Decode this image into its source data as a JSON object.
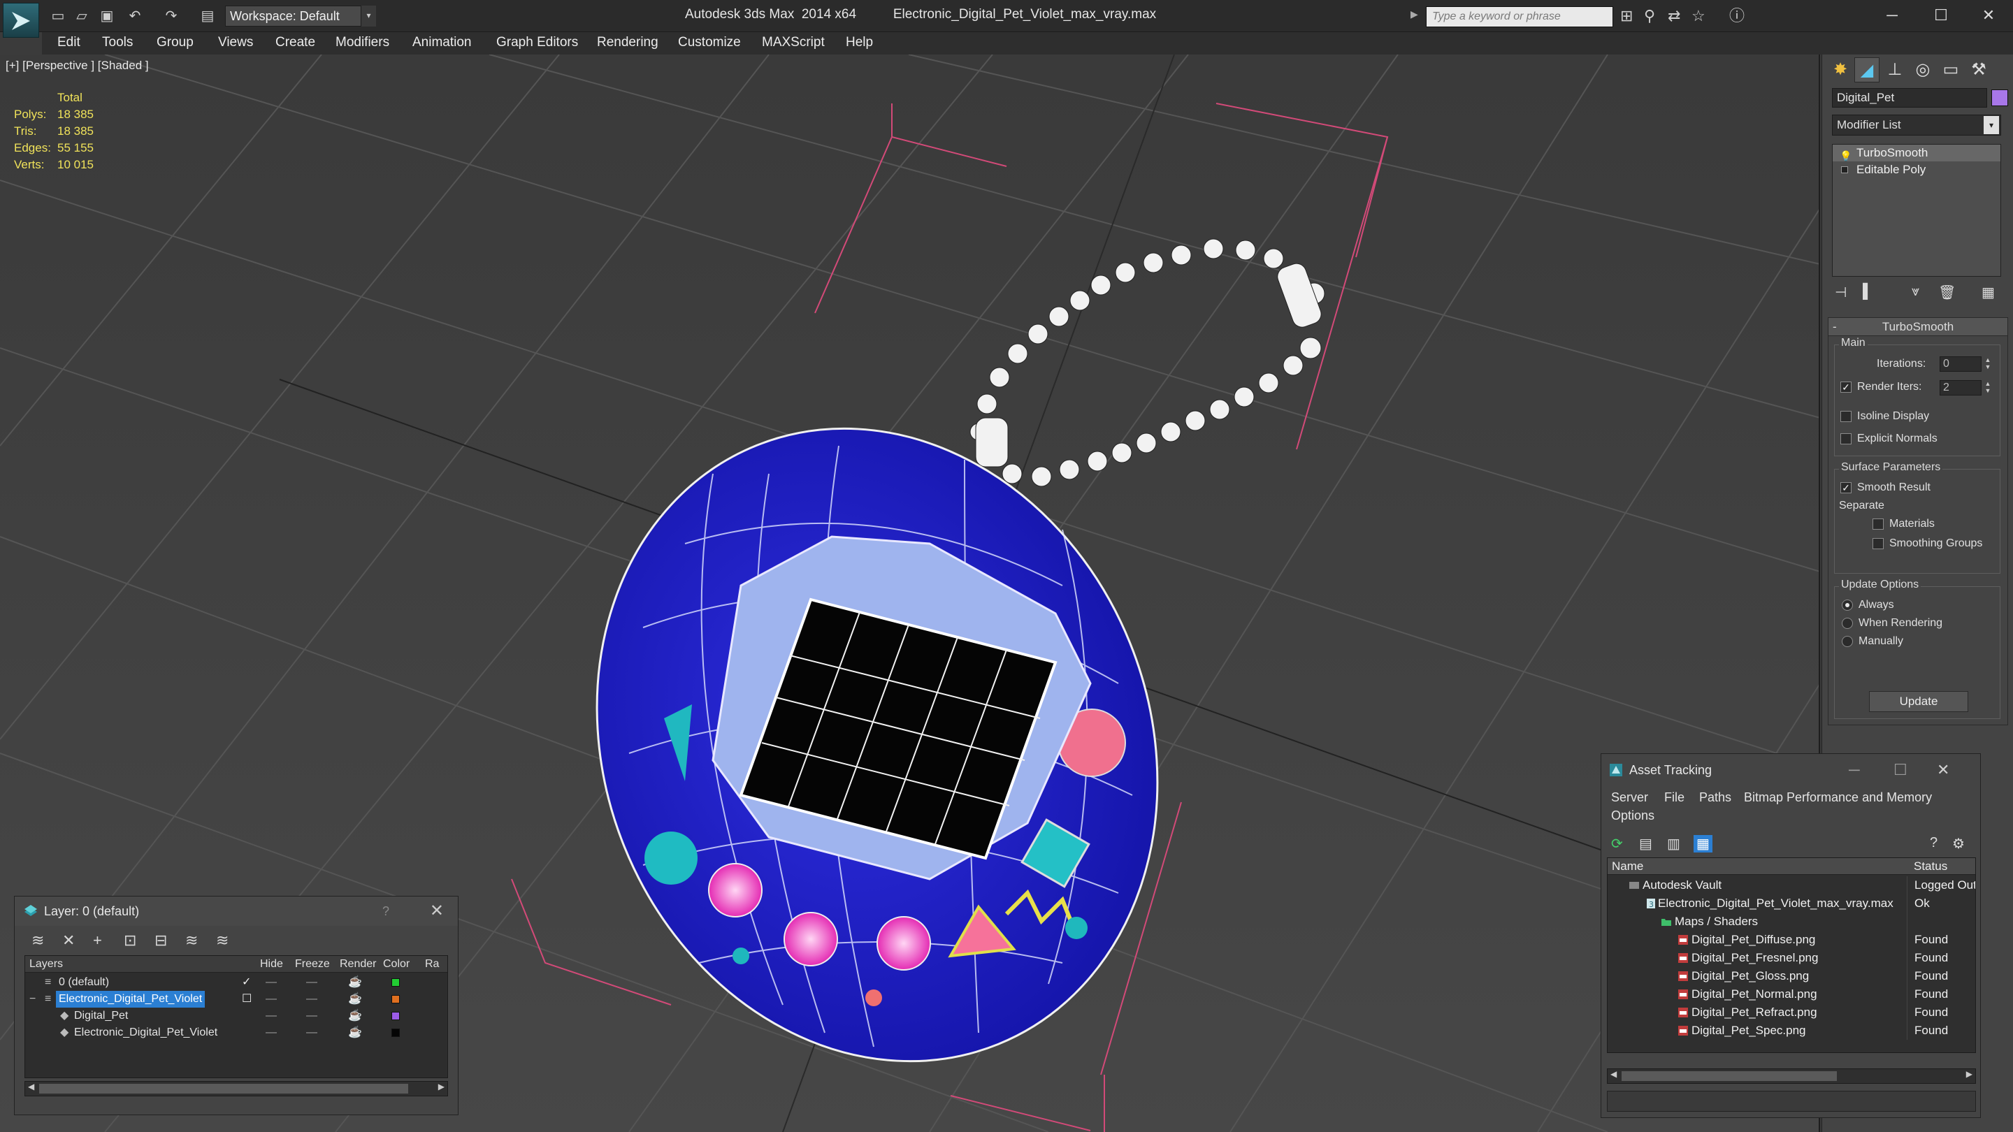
{
  "window": {
    "app_title": "Autodesk 3ds Max  2014 x64",
    "file_title": "Electronic_Digital_Pet_Violet_max_vray.max",
    "workspace": "Workspace: Default",
    "search_placeholder": "Type a keyword or phrase"
  },
  "menu": [
    "Edit",
    "Tools",
    "Group",
    "Views",
    "Create",
    "Modifiers",
    "Animation",
    "Graph Editors",
    "Rendering",
    "Customize",
    "MAXScript",
    "Help"
  ],
  "viewport": {
    "label": "[+] [Perspective ] [Shaded ]",
    "stats": {
      "header": "Total",
      "rows": [
        {
          "label": "Polys:",
          "value": "18 385"
        },
        {
          "label": "Tris:",
          "value": "18 385"
        },
        {
          "label": "Edges:",
          "value": "55 155"
        },
        {
          "label": "Verts:",
          "value": "10 015"
        }
      ]
    }
  },
  "command_panel": {
    "object_name": "Digital_Pet",
    "object_color": "#a877e9",
    "modifier_list": "Modifier List",
    "stack": [
      "TurboSmooth",
      "Editable Poly"
    ],
    "rollout_title": "TurboSmooth",
    "main_group": "Main",
    "iterations_label": "Iterations:",
    "iterations_value": "0",
    "render_iters_label": "Render Iters:",
    "render_iters_value": "2",
    "isoline_label": "Isoline Display",
    "explicit_normals_label": "Explicit Normals",
    "surface_group": "Surface Parameters",
    "smooth_result_label": "Smooth Result",
    "separate_label": "Separate",
    "materials_label": "Materials",
    "smoothing_groups_label": "Smoothing Groups",
    "update_group": "Update Options",
    "update_options": [
      "Always",
      "When Rendering",
      "Manually"
    ],
    "update_button": "Update"
  },
  "layer_dialog": {
    "title": "Layer: 0 (default)",
    "help": "?",
    "columns": [
      "Layers",
      "Hide",
      "Freeze",
      "Render",
      "Color",
      "Ra"
    ],
    "rows": [
      {
        "name": "0 (default)",
        "color": "#22cc33"
      },
      {
        "name": "Electronic_Digital_Pet_Violet",
        "color": "#e07020"
      },
      {
        "name": "Digital_Pet",
        "color": "#9c5ce8"
      },
      {
        "name": "Electronic_Digital_Pet_Violet",
        "color": "#050505"
      }
    ]
  },
  "asset_tracking": {
    "title": "Asset Tracking",
    "menu": [
      "Server",
      "File",
      "Paths",
      "Bitmap Performance and Memory",
      "Options"
    ],
    "columns": [
      "Name",
      "Status"
    ],
    "rows": [
      {
        "name": "Autodesk Vault",
        "status": "Logged Out"
      },
      {
        "name": "Electronic_Digital_Pet_Violet_max_vray.max",
        "status": "Ok"
      },
      {
        "name": "Maps / Shaders",
        "status": ""
      },
      {
        "name": "Digital_Pet_Diffuse.png",
        "status": "Found"
      },
      {
        "name": "Digital_Pet_Fresnel.png",
        "status": "Found"
      },
      {
        "name": "Digital_Pet_Gloss.png",
        "status": "Found"
      },
      {
        "name": "Digital_Pet_Normal.png",
        "status": "Found"
      },
      {
        "name": "Digital_Pet_Refract.png",
        "status": "Found"
      },
      {
        "name": "Digital_Pet_Spec.png",
        "status": "Found"
      }
    ]
  }
}
